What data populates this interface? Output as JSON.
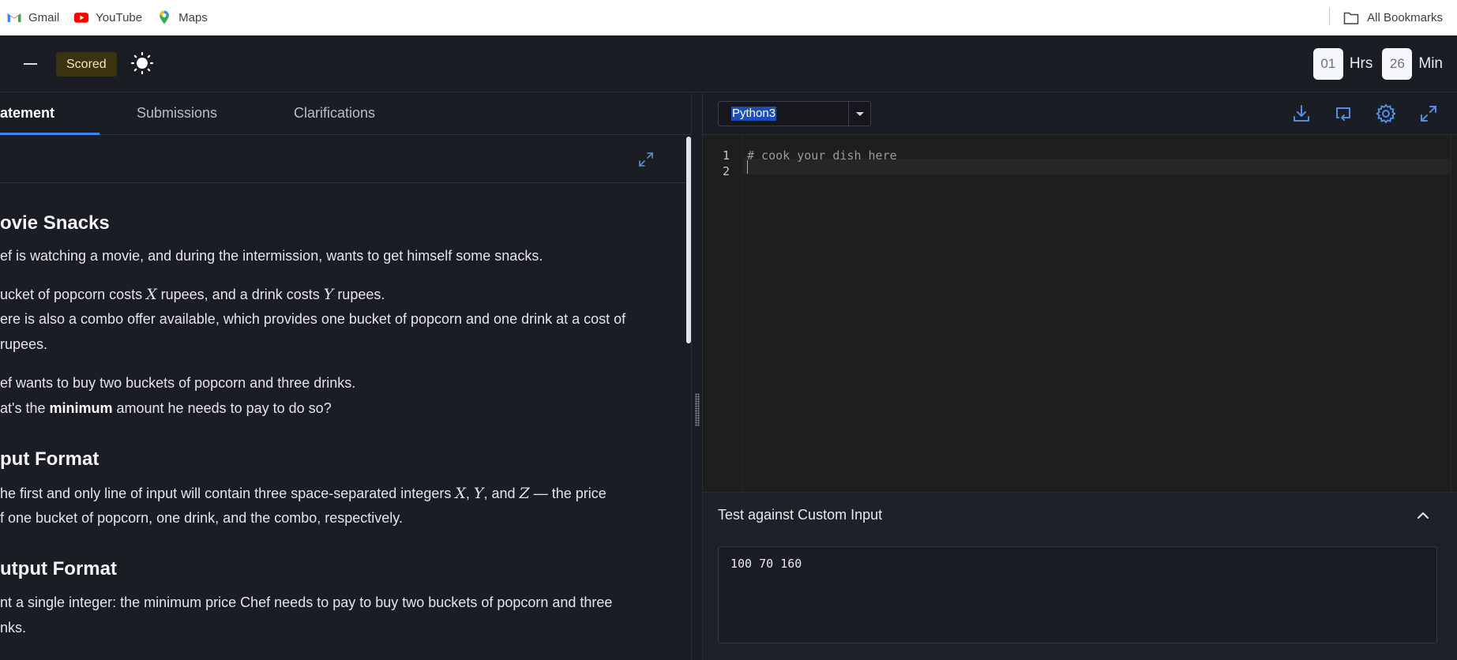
{
  "bookmarks": {
    "items": [
      {
        "label": "Gmail",
        "icon": "gmail-icon"
      },
      {
        "label": "YouTube",
        "icon": "youtube-icon"
      },
      {
        "label": "Maps",
        "icon": "maps-icon"
      }
    ],
    "all_bookmarks": "All Bookmarks"
  },
  "header": {
    "scored_label": "Scored",
    "timer": {
      "hours": "01",
      "hours_label": "Hrs",
      "minutes": "26",
      "minutes_label": "Min"
    }
  },
  "left": {
    "tabs": [
      "atement",
      "Submissions",
      "Clarifications"
    ],
    "problem": {
      "title": "ovie Snacks",
      "p1": "ef is watching a movie, and during the intermission, wants to get himself some snacks.",
      "p2a": "ucket of popcorn costs ",
      "var_x": "X",
      "p2b": " rupees, and a drink costs ",
      "var_y": "Y",
      "p2c": " rupees.",
      "p3a": "ere is also a combo offer available, which provides one bucket of popcorn and one drink at a cost of",
      "p3b": "rupees.",
      "p4": "ef wants to buy two buckets of popcorn and three drinks.",
      "p5a": "at's the ",
      "p5b": "minimum",
      "p5c": " amount he needs to pay to do so?",
      "input_heading": "put Format",
      "in1a": "he first and only line of input will contain three space-separated integers ",
      "in_x": "X",
      "in_sep1": ", ",
      "in_y": "Y",
      "in_sep2": ", and ",
      "in_z": "Z",
      "in1b": " — the price",
      "in2": "f one bucket of popcorn, one drink, and the combo, respectively.",
      "output_heading": "utput Format",
      "out1": "nt a single integer: the minimum price Chef needs to pay to buy two buckets of popcorn and three",
      "out2": "nks."
    }
  },
  "editor": {
    "language": "Python3",
    "lines": [
      {
        "no": "1",
        "text": "# cook your dish here"
      },
      {
        "no": "2",
        "text": ""
      }
    ]
  },
  "custom_input": {
    "title": "Test against Custom Input",
    "value": "100 70 160"
  }
}
